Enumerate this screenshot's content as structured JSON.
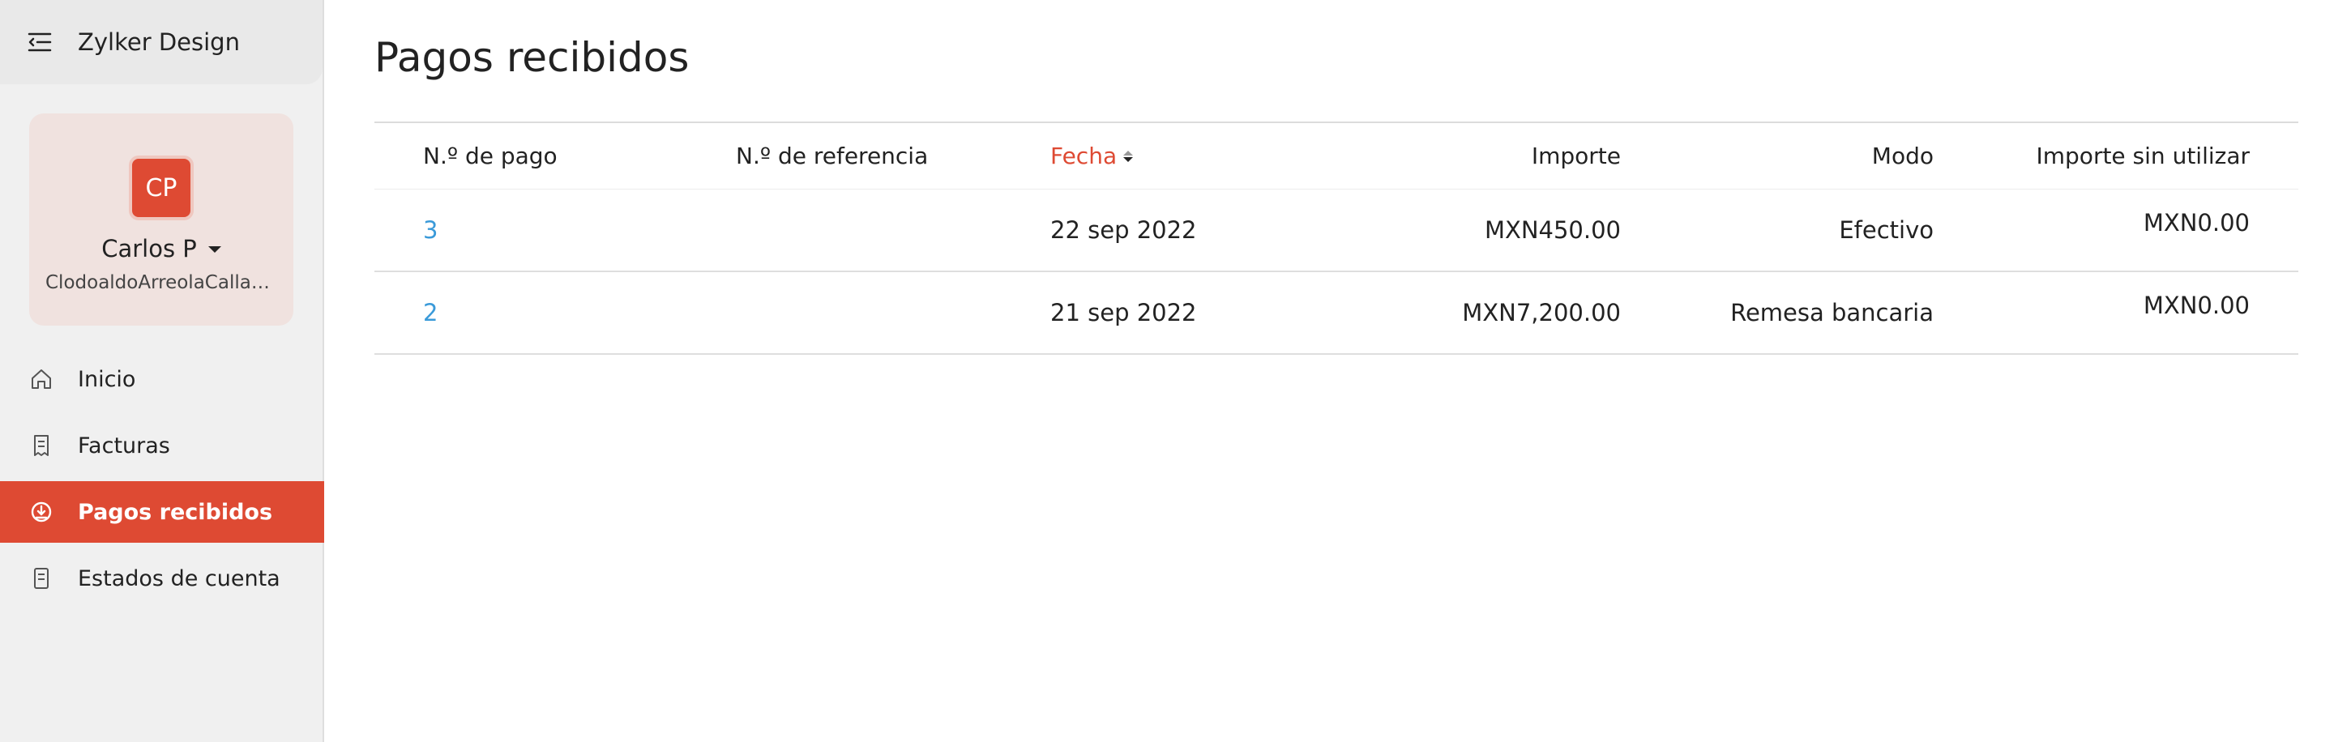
{
  "org": {
    "name": "Zylker Design"
  },
  "profile": {
    "initials": "CP",
    "name": "Carlos P",
    "email": "ClodoaldoArreolaCallas..."
  },
  "nav": {
    "items": [
      {
        "label": "Inicio",
        "icon": "home-icon",
        "active": false
      },
      {
        "label": "Facturas",
        "icon": "receipt-icon",
        "active": false
      },
      {
        "label": "Pagos recibidos",
        "icon": "payment-received-icon",
        "active": true
      },
      {
        "label": "Estados de cuenta",
        "icon": "statement-icon",
        "active": false
      }
    ]
  },
  "page": {
    "title": "Pagos recibidos"
  },
  "table": {
    "headers": {
      "payment_no": "N.º de pago",
      "reference_no": "N.º de referencia",
      "date": "Fecha",
      "amount": "Importe",
      "mode": "Modo",
      "unused_amount": "Importe sin utilizar"
    },
    "rows": [
      {
        "payment_no": "3",
        "reference_no": "",
        "date": "22 sep 2022",
        "amount": "MXN450.00",
        "mode": "Efectivo",
        "unused_amount": "MXN0.00"
      },
      {
        "payment_no": "2",
        "reference_no": "",
        "date": "21 sep 2022",
        "amount": "MXN7,200.00",
        "mode": "Remesa bancaria",
        "unused_amount": "MXN0.00"
      }
    ]
  },
  "colors": {
    "accent": "#de4a33",
    "link": "#3a9ad9",
    "sidebar_bg": "#f0f0f0"
  }
}
